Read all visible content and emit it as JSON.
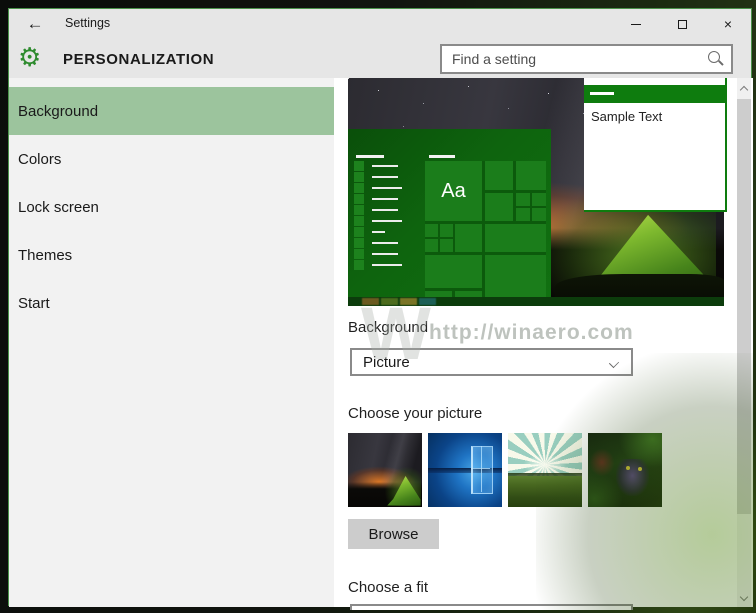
{
  "window": {
    "title": "Settings",
    "back_icon": "←",
    "controls": {
      "minimize": "minimize-icon",
      "maximize": "maximize-icon",
      "close": "close-icon",
      "close_glyph": "×"
    }
  },
  "header": {
    "page_title": "PERSONALIZATION",
    "gear_icon": "⚙",
    "search": {
      "placeholder": "Find a setting",
      "icon": "magnifier-icon"
    }
  },
  "sidebar": {
    "items": [
      {
        "label": "Background",
        "selected": true
      },
      {
        "label": "Colors",
        "selected": false
      },
      {
        "label": "Lock screen",
        "selected": false
      },
      {
        "label": "Themes",
        "selected": false
      },
      {
        "label": "Start",
        "selected": false
      }
    ]
  },
  "preview": {
    "sample_window_text": "Sample Text",
    "start_tile_text": "Aa"
  },
  "main": {
    "background_label": "Background",
    "background_dropdown_value": "Picture",
    "choose_picture_label": "Choose your picture",
    "thumbnails": [
      {
        "name": "night-sky-tent"
      },
      {
        "name": "windows-10-hero"
      },
      {
        "name": "sunrise-field-rays"
      },
      {
        "name": "jungle-panther"
      }
    ],
    "browse_label": "Browse",
    "choose_fit_label": "Choose a fit"
  },
  "watermark": {
    "logo": "W",
    "url": "http://winaero.com"
  },
  "colors": {
    "accent_green": "#0e7c0e",
    "nav_highlight": "#9cc49d",
    "chrome_gray": "#e6e6e6",
    "sidebar_gray": "#f2f2f2",
    "browse_gray": "#cccccc"
  }
}
